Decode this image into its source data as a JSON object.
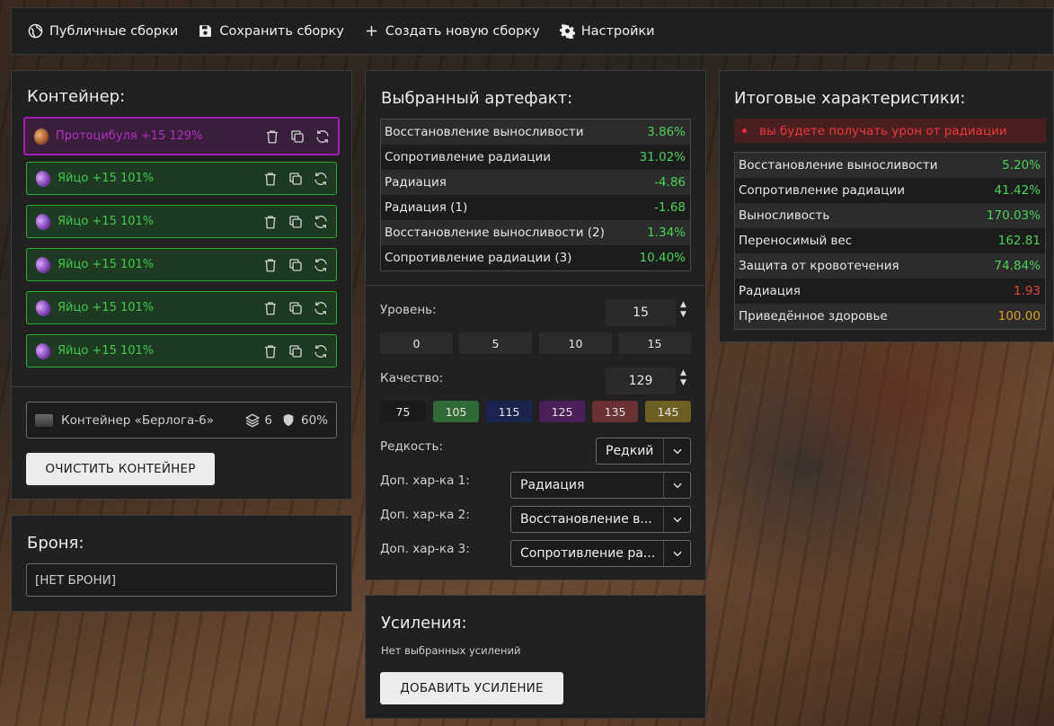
{
  "topbar": {
    "public_label": "Публичные сборки",
    "save_label": "Сохранить сборку",
    "new_label": "Создать новую сборку",
    "settings_label": "Настройки"
  },
  "container": {
    "title": "Контейнер:",
    "slots": [
      {
        "name": "Протоцибуля +15 129%",
        "icon": "onion-icon",
        "selected": true
      },
      {
        "name": "Яйцо +15 101%",
        "icon": "egg-icon"
      },
      {
        "name": "Яйцо +15 101%",
        "icon": "egg-icon"
      },
      {
        "name": "Яйцо +15 101%",
        "icon": "egg-icon"
      },
      {
        "name": "Яйцо +15 101%",
        "icon": "egg-icon"
      },
      {
        "name": "Яйцо +15 101%",
        "icon": "egg-icon"
      }
    ],
    "info": {
      "name": "Контейнер «Берлога-6»",
      "slots": "6",
      "protection": "60%"
    },
    "clear_label": "ОЧИСТИТЬ КОНТЕЙНЕР"
  },
  "armor": {
    "title": "Броня:",
    "value": "[НЕТ БРОНИ]"
  },
  "artifact": {
    "title": "Выбранный артефакт:",
    "stats": [
      {
        "name": "Восстановление выносливости",
        "value": "3.86%"
      },
      {
        "name": "Сопротивление радиации",
        "value": "31.02%"
      },
      {
        "name": "Радиация",
        "value": "-4.86"
      },
      {
        "name": "Радиация (1)",
        "value": "-1.68"
      },
      {
        "name": "Восстановление выносливости (2)",
        "value": "1.34%"
      },
      {
        "name": "Сопротивление радиации (3)",
        "value": "10.40%"
      }
    ],
    "level_label": "Уровень:",
    "level_value": "15",
    "level_presets": [
      "0",
      "5",
      "10",
      "15"
    ],
    "quality_label": "Качество:",
    "quality_value": "129",
    "quality_presets": [
      {
        "label": "75",
        "color": "#1a1a1a"
      },
      {
        "label": "105",
        "color": "#2f6b35"
      },
      {
        "label": "115",
        "color": "#1b2350"
      },
      {
        "label": "125",
        "color": "#4a1f5a"
      },
      {
        "label": "135",
        "color": "#6a3034"
      },
      {
        "label": "145",
        "color": "#6b5f24"
      }
    ],
    "rarity_label": "Редкость:",
    "rarity_value": "Редкий",
    "extra1_label": "Доп. хар-ка 1:",
    "extra1_value": "Радиация",
    "extra2_label": "Доп. хар-ка 2:",
    "extra2_value": "Восстановление в...",
    "extra3_label": "Доп. хар-ка 3:",
    "extra3_value": "Сопротивление ра..."
  },
  "boosts": {
    "title": "Усиления:",
    "empty": "Нет выбранных усилений",
    "add_label": "ДОБАВИТЬ УСИЛЕНИЕ"
  },
  "totals": {
    "title": "Итоговые характеристики:",
    "warning": "вы будете получать урон от радиации",
    "stats": [
      {
        "name": "Восстановление выносливости",
        "value": "5.20%",
        "color": "#4bd05a"
      },
      {
        "name": "Сопротивление радиации",
        "value": "41.42%",
        "color": "#4bd05a"
      },
      {
        "name": "Выносливость",
        "value": "170.03%",
        "color": "#4bd05a"
      },
      {
        "name": "Переносимый вес",
        "value": "162.81",
        "color": "#4bd05a"
      },
      {
        "name": "Защита от кровотечения",
        "value": "74.84%",
        "color": "#4bd05a"
      },
      {
        "name": "Радиация",
        "value": "1.93",
        "color": "#e0443c"
      },
      {
        "name": "Приведённое здоровье",
        "value": "100.00",
        "color": "#e0a020"
      }
    ]
  }
}
